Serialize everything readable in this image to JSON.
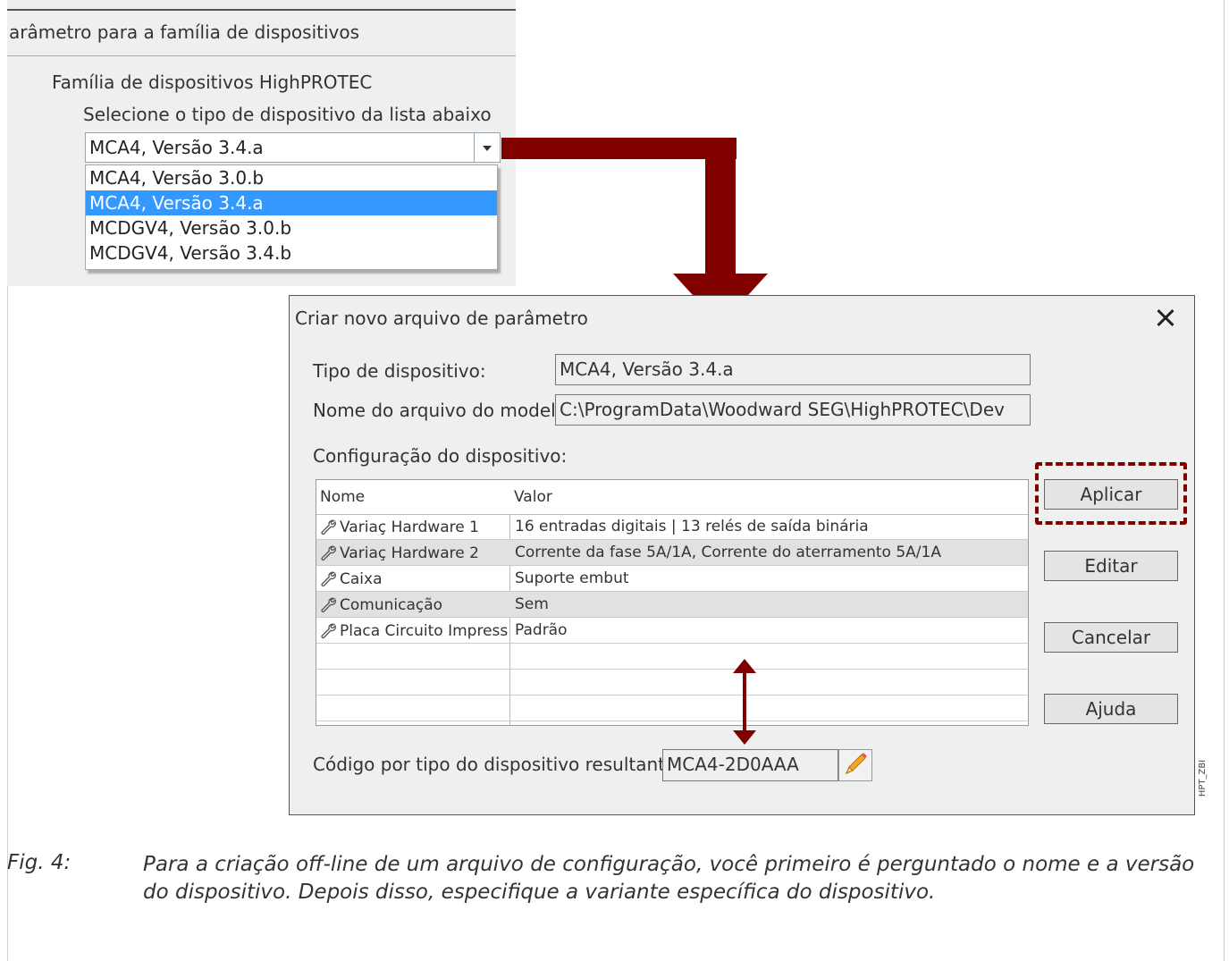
{
  "panel": {
    "title": "arâmetro para a família de dispositivos",
    "family_label": "Família de dispositivos HighPROTEC",
    "select_label": "Selecione o tipo de dispositivo da lista abaixo",
    "combo_value": "MCA4, Versão 3.4.a",
    "options": [
      "MCA4, Versão 3.0.b",
      "MCA4, Versão 3.4.a",
      "MCDGV4, Versão 3.0.b",
      "MCDGV4, Versão 3.4.b"
    ],
    "selected_option": "MCA4, Versão 3.4.a"
  },
  "dialog": {
    "title": "Criar novo arquivo de parâmetro",
    "device_type_label": "Tipo de dispositivo:",
    "device_type_value": "MCA4, Versão 3.4.a",
    "template_label": "Nome do arquivo do modelo do dispositivo",
    "template_value": "C:\\ProgramData\\Woodward SEG\\HighPROTEC\\Dev",
    "config_label": "Configuração do dispositivo:",
    "table": {
      "headers": [
        "Nome",
        "Valor"
      ],
      "rows": [
        {
          "name": "Variaç Hardware 1",
          "value": "16 entradas digitais | 13 relés de saída binária"
        },
        {
          "name": "Variaç Hardware 2",
          "value": "Corrente da fase 5A/1A, Corrente do aterramento 5A/1A"
        },
        {
          "name": "Caixa",
          "value": "Suporte embut"
        },
        {
          "name": "Comunicação",
          "value": "Sem"
        },
        {
          "name": "Placa Circuito Impresso",
          "value": "Padrão"
        }
      ]
    },
    "result_label": "Código por tipo do dispositivo resultante",
    "result_value": "MCA4-2D0AAA",
    "buttons": {
      "apply": "Aplicar",
      "edit": "Editar",
      "cancel": "Cancelar",
      "help": "Ajuda"
    }
  },
  "caption": {
    "label": "Fig. 4:",
    "text": "Para a criação off-line de um arquivo de configuração, você primeiro é perguntado o nome e a versão do dispositivo. Depois disso, especifique a variante específica do dispositivo."
  },
  "side_tag": "HPT_ZBI",
  "colors": {
    "arrow": "#800000",
    "selection": "#3399ff",
    "dialog_bg": "#efefef"
  },
  "icons": {
    "table_row": "wrench-icon",
    "edit_code": "pencil-icon",
    "close": "close-icon",
    "dropdown": "chevron-down-icon"
  }
}
